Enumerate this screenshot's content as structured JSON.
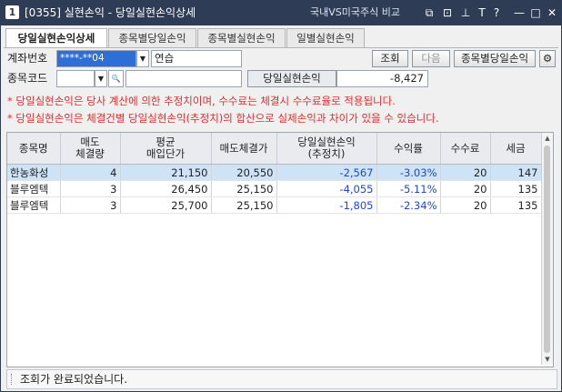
{
  "title": {
    "num": "1",
    "text": "[0355] 실현손익 - 당일실현손익상세",
    "right_text": "국내VS미국주식 비교",
    "controls": [
      "⧉",
      "⊡",
      "⊥",
      "T",
      "?",
      "—",
      "□",
      "✕"
    ]
  },
  "tabs": [
    {
      "label": "당일실현손익상세"
    },
    {
      "label": "종목별당일손익"
    },
    {
      "label": "종목별실현손익"
    },
    {
      "label": "일별실현손익"
    }
  ],
  "form": {
    "account_label": "계좌번호",
    "account_value": "****-**04",
    "account_name": "연습",
    "query_button": "조회",
    "next_button": "다음",
    "item_button": "종목별당일손익",
    "code_label": "종목코드",
    "code_value": "",
    "code_name": "",
    "daily_label": "당일실현손익",
    "daily_value": "-8,427"
  },
  "notices": [
    "* 당일실현손익은 당사 계산에 의한 추정치이며, 수수료는 체결시 수수료율로 적용됩니다.",
    "* 당일실현손익은 체결건별 당일실현손익(추정치)의 합산으로 실제손익과 차이가 있을 수 있습니다."
  ],
  "table": {
    "headers": [
      [
        "종목명"
      ],
      [
        "매도",
        "체결량"
      ],
      [
        "평균",
        "매입단가"
      ],
      [
        "매도체결가"
      ],
      [
        "당일실현손익",
        "(추정치)"
      ],
      [
        "수익률"
      ],
      [
        "수수료"
      ],
      [
        "세금"
      ]
    ],
    "rows": [
      [
        "한농화성",
        "4",
        "21,150",
        "20,550",
        "-2,567",
        "-3.03%",
        "20",
        "147"
      ],
      [
        "블루엠텍",
        "3",
        "26,450",
        "25,150",
        "-4,055",
        "-5.11%",
        "20",
        "135"
      ],
      [
        "블루엠텍",
        "3",
        "25,700",
        "25,150",
        "-1,805",
        "-2.34%",
        "20",
        "135"
      ]
    ]
  },
  "status": "조회가 완료되었습니다."
}
